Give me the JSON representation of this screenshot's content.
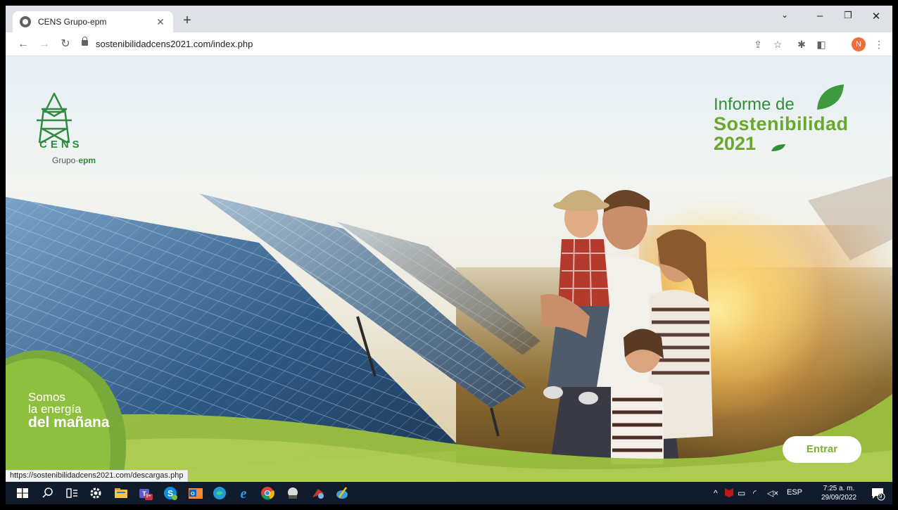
{
  "browser": {
    "tab_title": "CENS Grupo-epm",
    "url": "sostenibilidadcens2021.com/index.php",
    "profile_initial": "N",
    "status_url": "https://sostenibilidadcens2021.com/descargas.php"
  },
  "page": {
    "logo_text": "CENS",
    "grupo_prefix": "Grupo·",
    "grupo_brand": "epm",
    "report_line1": "Informe de",
    "report_line2": "Sostenibilidad",
    "report_line3": "2021",
    "tagline_1": "Somos",
    "tagline_2": "la energía",
    "tagline_3": "del mañana",
    "enter_button": "Entrar"
  },
  "taskbar": {
    "language": "ESP",
    "time": "7:25 a. m.",
    "date": "29/09/2022",
    "notification_count": "9",
    "teams_badge": "9+"
  },
  "colors": {
    "brand_green": "#2f8f3a",
    "light_green": "#6aa72d",
    "wave_green": "#8fbf3e"
  }
}
